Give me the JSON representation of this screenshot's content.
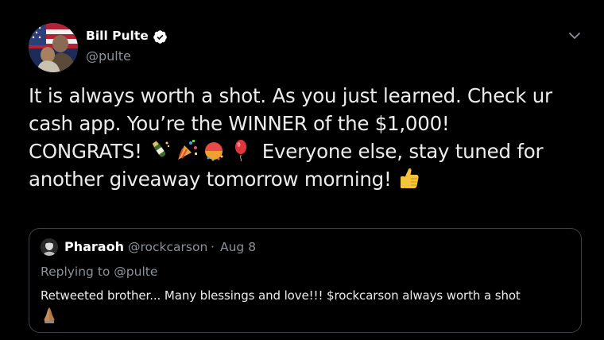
{
  "tweet": {
    "author": {
      "name": "Bill Pulte",
      "handle": "@pulte",
      "verified": true
    },
    "menu_icon": "chevron-down-icon",
    "body_lines": [
      "It is always worth a shot. As you just learned. Check ur",
      "cash app. You’re the WINNER of the $1,000!",
      "CONGRATS!",
      "Everyone else, stay tuned for",
      "another giveaway tomorrow morning!"
    ],
    "body_emojis": [
      "champagne-emoji",
      "party-popper-emoji",
      "confetti-ball-emoji",
      "balloon-emoji",
      "thumbs-up-emoji"
    ],
    "quoted": {
      "name": "Pharaoh",
      "handle": "@rockcarson",
      "separator": "·",
      "date": "Aug 8",
      "replying_to": "Replying to @pulte",
      "text": "Retweeted brother... Many blessings and love!!! $rockcarson always worth a shot",
      "trailing_emoji": "folded-hands-emoji"
    }
  },
  "colors": {
    "background": "#000000",
    "text_primary": "#ffffff",
    "text_secondary": "#8b9299",
    "border": "#3d4248",
    "verified_badge": "#ffffff"
  }
}
